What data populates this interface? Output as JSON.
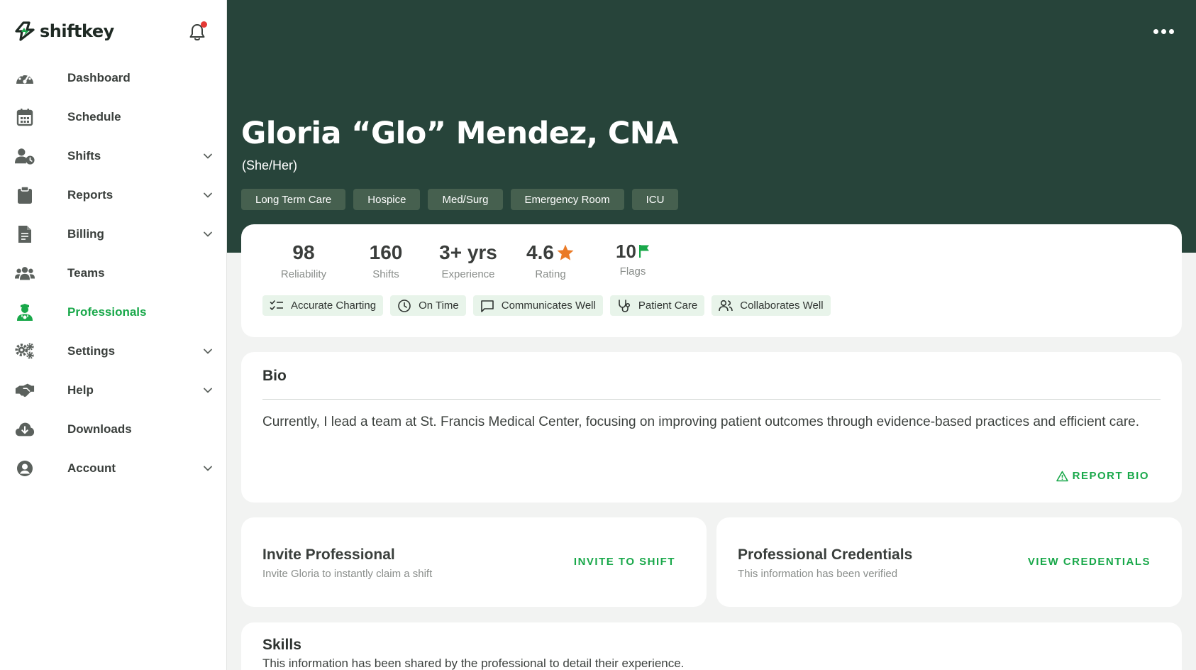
{
  "brand": {
    "name": "shiftkey",
    "accent": "#19a84a"
  },
  "notifications": {
    "has_unread": true
  },
  "sidebar": {
    "items": [
      {
        "label": "Dashboard",
        "icon": "gauge-icon",
        "expandable": false,
        "active": false
      },
      {
        "label": "Schedule",
        "icon": "calendar-icon",
        "expandable": false,
        "active": false
      },
      {
        "label": "Shifts",
        "icon": "user-clock-icon",
        "expandable": true,
        "active": false
      },
      {
        "label": "Reports",
        "icon": "clipboard-icon",
        "expandable": true,
        "active": false
      },
      {
        "label": "Billing",
        "icon": "invoice-icon",
        "expandable": true,
        "active": false
      },
      {
        "label": "Teams",
        "icon": "users-icon",
        "expandable": false,
        "active": false
      },
      {
        "label": "Professionals",
        "icon": "user-nurse-icon",
        "expandable": false,
        "active": true
      },
      {
        "label": "Settings",
        "icon": "gears-icon",
        "expandable": true,
        "active": false
      },
      {
        "label": "Help",
        "icon": "handshake-icon",
        "expandable": true,
        "active": false
      },
      {
        "label": "Downloads",
        "icon": "cloud-download-icon",
        "expandable": false,
        "active": false
      },
      {
        "label": "Account",
        "icon": "user-circle-icon",
        "expandable": true,
        "active": false
      }
    ]
  },
  "profile": {
    "name": "Gloria “Glo” Mendez, CNA",
    "pronouns": "(She/Her)",
    "tags": [
      "Long Term Care",
      "Hospice",
      "Med/Surg",
      "Emergency Room",
      "ICU"
    ],
    "header_color": "#27443a"
  },
  "stats": [
    {
      "value": "98",
      "label": "Reliability",
      "icon": ""
    },
    {
      "value": "160",
      "label": "Shifts",
      "icon": ""
    },
    {
      "value": "3+ yrs",
      "label": "Experience",
      "icon": ""
    },
    {
      "value": "4.6",
      "label": "Rating",
      "icon": "star-icon"
    },
    {
      "value": "10",
      "label": "Flags",
      "icon": "flag-icon"
    }
  ],
  "badges": [
    {
      "label": "Accurate Charting",
      "icon": "checklist-icon"
    },
    {
      "label": "On Time",
      "icon": "clock-icon"
    },
    {
      "label": "Communicates Well",
      "icon": "chat-bubble-icon"
    },
    {
      "label": "Patient Care",
      "icon": "stethoscope-icon"
    },
    {
      "label": "Collaborates Well",
      "icon": "people-icon"
    }
  ],
  "bio": {
    "title": "Bio",
    "text": "Currently, I lead a team at St. Francis Medical Center, focusing on improving patient outcomes through evidence-based practices and efficient care.",
    "report_label": "REPORT BIO"
  },
  "invite": {
    "title": "Invite Professional",
    "subtitle": "Invite Gloria to instantly claim a shift",
    "action": "INVITE TO SHIFT"
  },
  "credentials": {
    "title": "Professional Credentials",
    "subtitle": "This information has been verified",
    "action": "VIEW CREDENTIALS"
  },
  "skills": {
    "title": "Skills",
    "subtitle": "This information has been shared by the professional to detail their experience."
  }
}
